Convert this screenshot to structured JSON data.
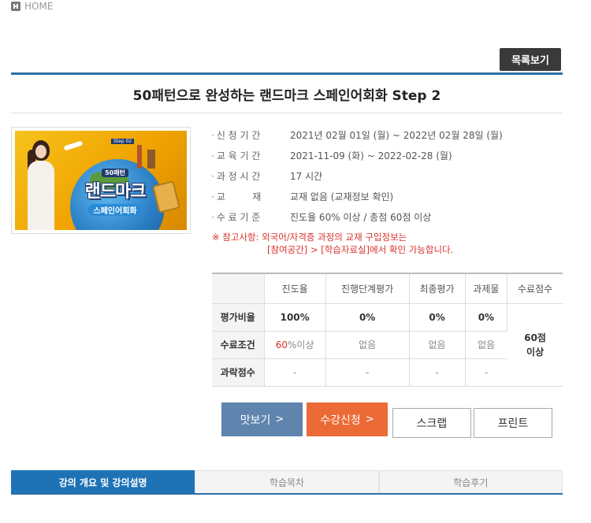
{
  "breadcrumb": {
    "home_label": "HOME"
  },
  "header": {
    "list_button": "목록보기"
  },
  "course": {
    "title": "50패턴으로 완성하는 랜드마크 스페인어회화 Step 2"
  },
  "thumbnail": {
    "tag": "Step 02",
    "line1": "50패턴",
    "line2": "랜드마크",
    "line3": "스페인어회화"
  },
  "info": [
    {
      "label": "신 청 기 간",
      "value": "2021년 02월 01일 (월) ~ 2022년 02월 28일 (월)"
    },
    {
      "label": "교 육 기 간",
      "value": "2021-11-09 (화) ~ 2022-02-28 (월)"
    },
    {
      "label": "과 정 시 간",
      "value": "17 시간"
    },
    {
      "label": "교         재",
      "value": "교재 없음 (교재정보 확인)"
    },
    {
      "label": "수 료 기 준",
      "value": "진도율 60% 이상 / 총점 60점 이상"
    }
  ],
  "notice": {
    "line1": "※ 참고사항: 외국어/자격증 과정의 교재 구입정보는",
    "line2": "[참여공간] > [학습자료실]에서 확인 가능합니다."
  },
  "grade_table": {
    "headers": [
      "진도율",
      "진행단계평가",
      "최종평가",
      "과제물",
      "수료점수"
    ],
    "rows": [
      {
        "label": "평가비율",
        "cells": [
          "100%",
          "0%",
          "0%",
          "0%"
        ]
      },
      {
        "label": "수료조건",
        "cells": [
          "60",
          "없음",
          "없음",
          "없음"
        ],
        "first_suffix": "%이상"
      },
      {
        "label": "과락점수",
        "cells": [
          "-",
          "-",
          "-",
          "-"
        ]
      }
    ],
    "pass_score_line1": "60점",
    "pass_score_line2": "이상"
  },
  "actions": {
    "preview": "맛보기",
    "apply": "수강신청",
    "scrap": "스크랩",
    "print": "프린트",
    "chevron": ">"
  },
  "tabs": [
    {
      "label": "강의 개요 및 강의설명",
      "active": true
    },
    {
      "label": "학습목차",
      "active": false
    },
    {
      "label": "학습후기",
      "active": false
    }
  ],
  "colors": {
    "accent": "#2b6fa8",
    "tab_active": "#1e73b6",
    "preview_button": "#5f84ae",
    "apply_button": "#ec6a35",
    "notice_red": "#d9322c"
  }
}
